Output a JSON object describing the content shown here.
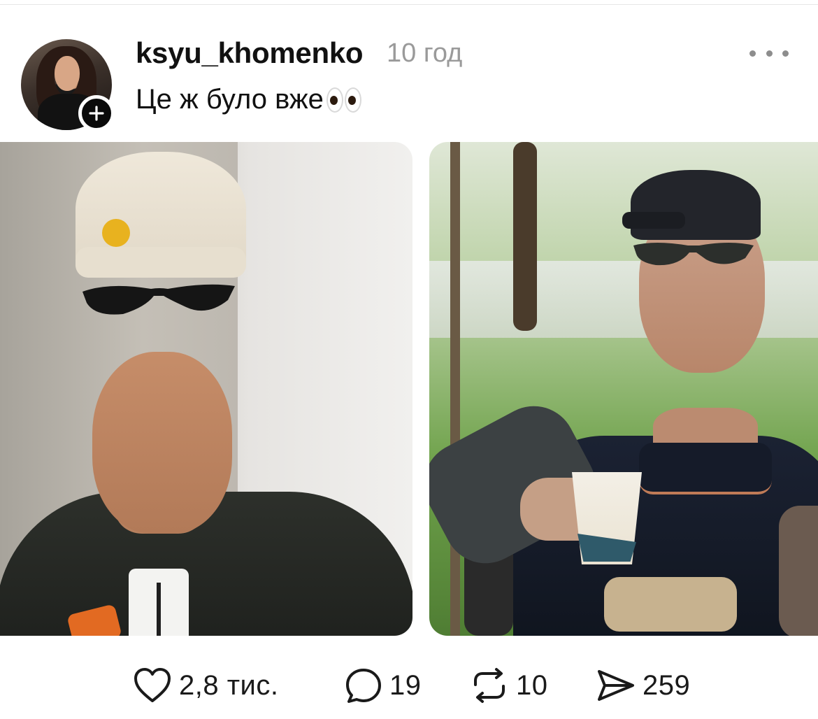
{
  "post": {
    "username": "ksyu_khomenko",
    "time": "10 год",
    "caption": "Це ж було вже",
    "caption_emoji": "eyes-emoji-icon"
  },
  "icons": {
    "more": "more-dots-icon",
    "follow": "plus-icon",
    "like": "heart-icon",
    "comment": "comment-bubble-icon",
    "repost": "repost-icon",
    "share": "send-icon"
  },
  "stats": {
    "likes": "2,8 тис.",
    "comments": "19",
    "reposts": "10",
    "shares": "259"
  },
  "colors": {
    "text": "#111111",
    "muted": "#9a9a9a",
    "badge": "#0a0a0a"
  }
}
